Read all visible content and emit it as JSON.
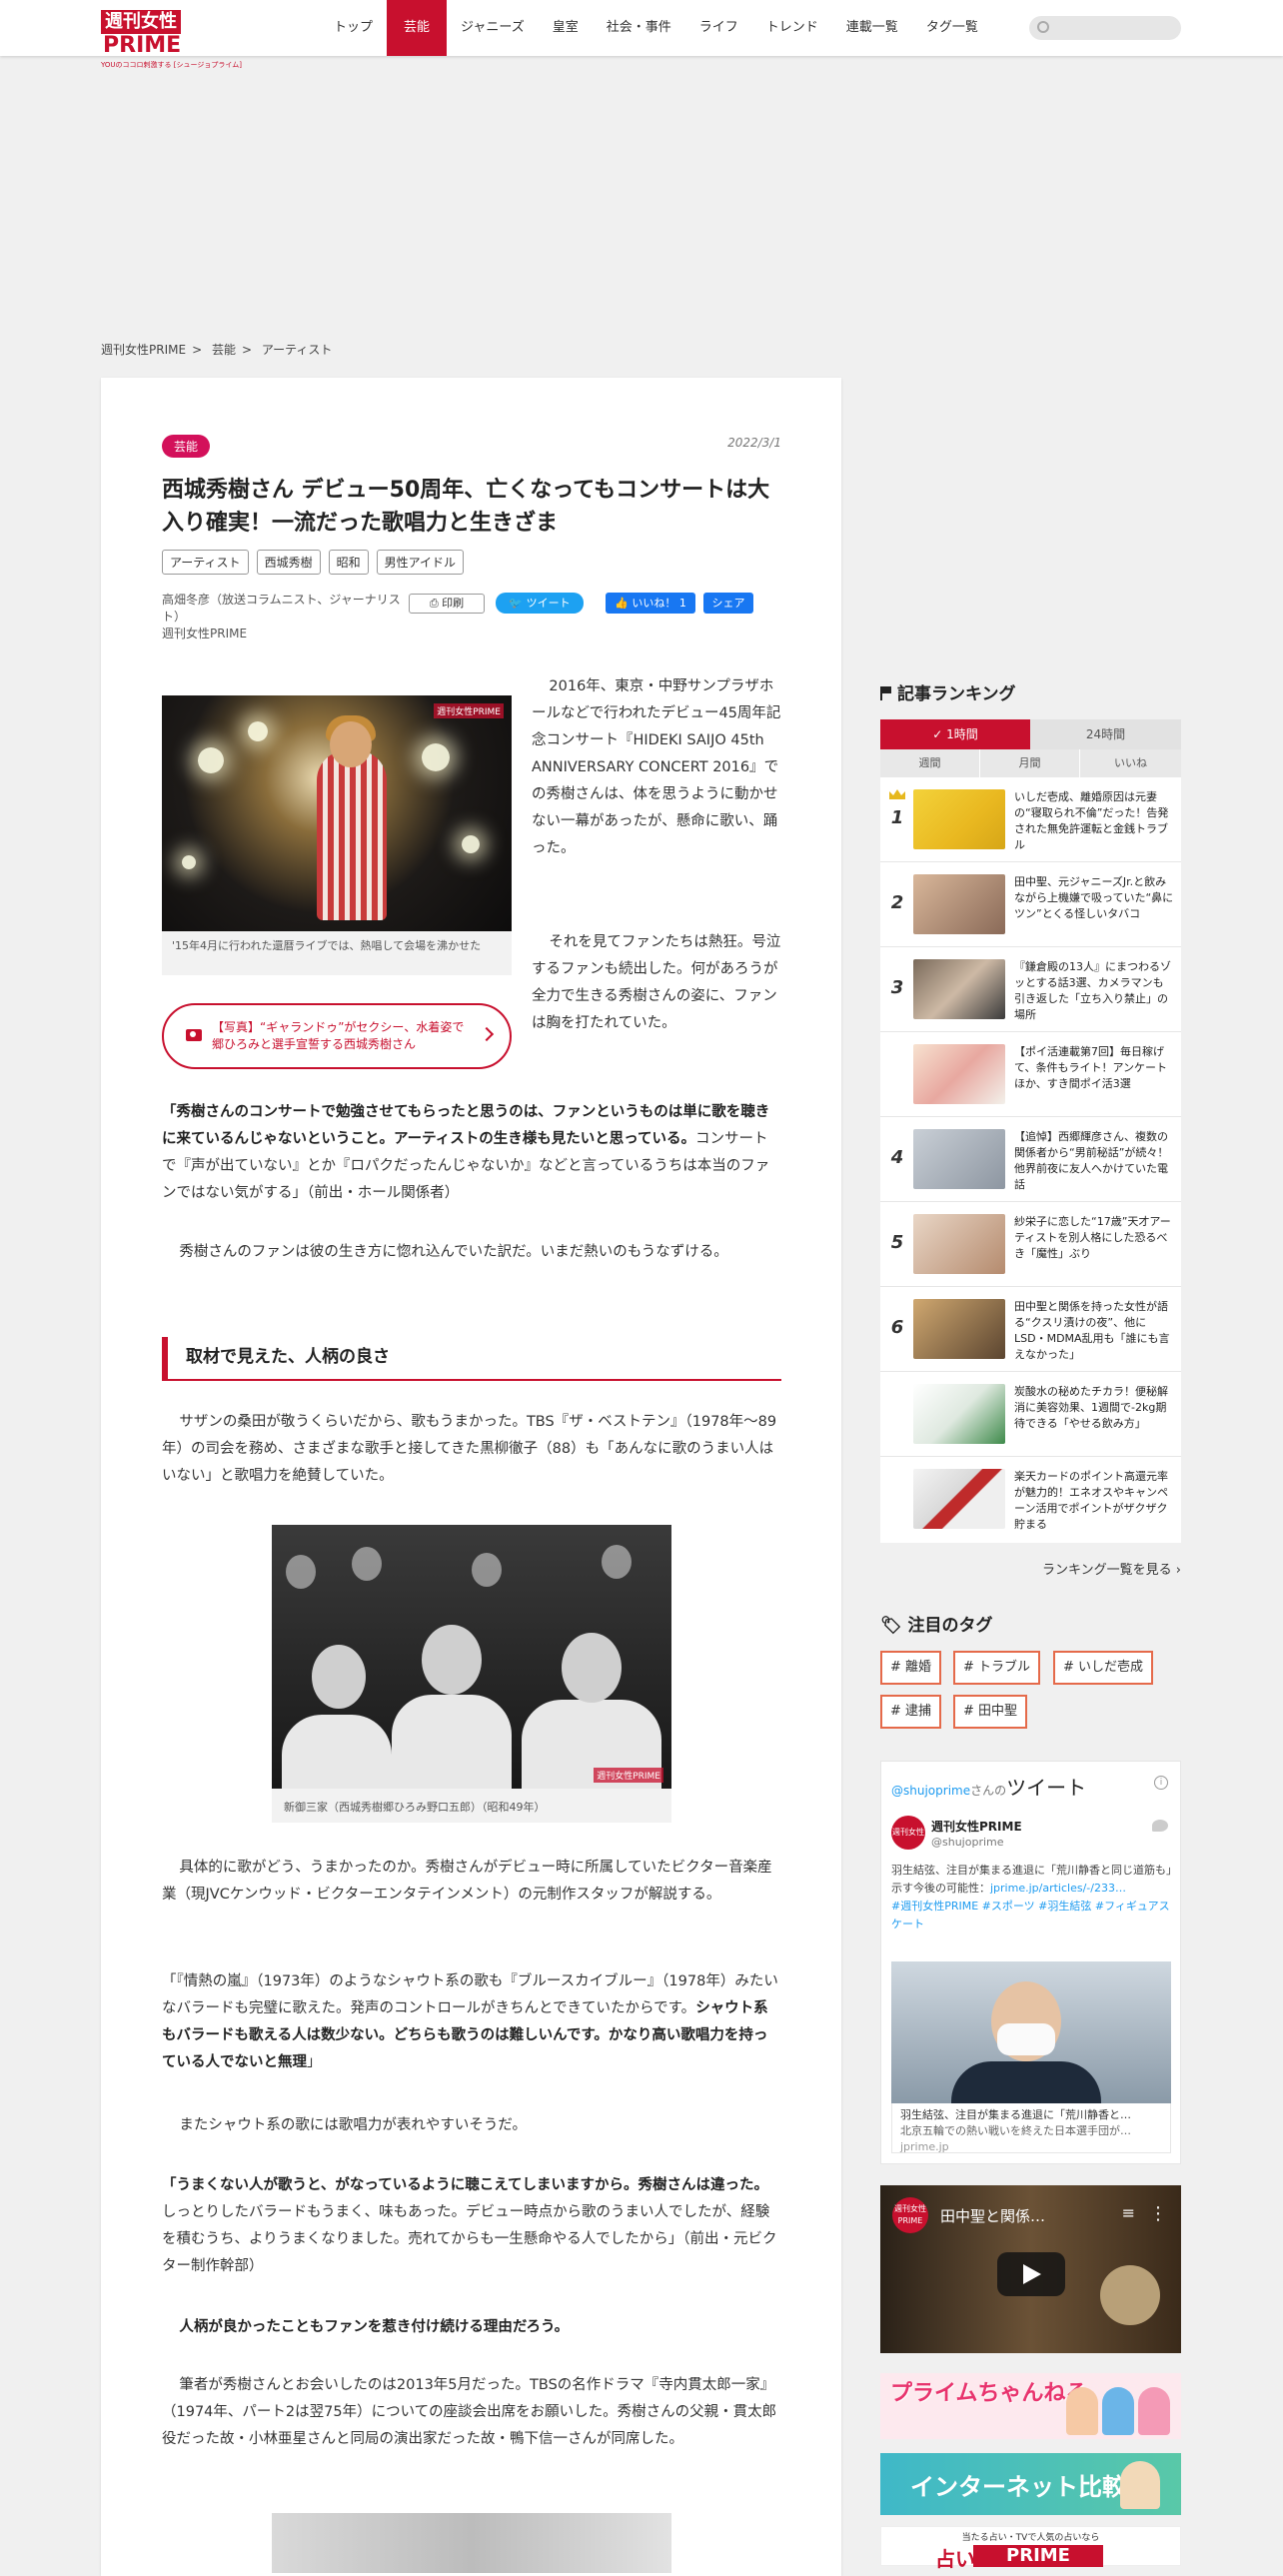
{
  "header": {
    "logo_main": "週刊女性",
    "logo_prime": "PRIME",
    "logo_sub": "YOUのココロ刺激する [シュージョプライム]",
    "nav": [
      "トップ",
      "芸能",
      "ジャニーズ",
      "皇室",
      "社会・事件",
      "ライフ",
      "トレンド",
      "連載一覧",
      "タグ一覧"
    ],
    "nav_active": "芸能",
    "search_placeholder": ""
  },
  "breadcrumb": [
    "週刊女性PRIME",
    "芸能",
    "アーティスト"
  ],
  "breadcrumb_sep": ">",
  "article": {
    "category": "芸能",
    "date": "2022/3/1",
    "title": "西城秀樹さん デビュー50周年、亡くなってもコンサートは大入り確実！一流だった歌唱力と生きざま",
    "tags": [
      "アーティスト",
      "西城秀樹",
      "昭和",
      "男性アイドル"
    ],
    "author": "高畑冬彦（放送コラムニスト、ジャーナリスト）",
    "publisher": "週刊女性PRIME",
    "print_label": "印刷",
    "tweet_label": "ツイート",
    "like_label": "いいね！ 1",
    "share_label": "シェア",
    "watermark": "週刊女性PRIME",
    "photo1_caption": "'15年4月に行われた還暦ライブでは、熱唱して会場を沸かせた",
    "photo_link": "【写真】“ギャランドゥ”がセクシー、水着姿で郷ひろみと選手宣誓する西城秀樹さん",
    "p1": "2016年、東京・中野サンプラザホールなどで行われたデビュー45周年記念コンサート『HIDEKI SAIJO 45th ANNIVERSARY CONCERT 2016』での秀樹さんは、体を思うように動かせない一幕があったが、懸命に歌い、踊った。",
    "p2": "それを見てファンたちは熱狂。号泣するファンも続出した。何があろうが全力で生きる秀樹さんの姿に、ファンは胸を打たれていた。",
    "p3_bold": "「秀樹さんのコンサートで勉強させてもらったと思うのは、ファンというものは単に歌を聴きに来ているんじゃないということ。アーティストの生き様も見たいと思っている。",
    "p3_rest": "コンサートで『声が出ていない』とか『ロパクだったんじゃないか』などと言っているうちは本当のファンではない気がする」（前出・ホール関係者）",
    "p4": "秀樹さんのファンは彼の生き方に惚れ込んでいた訳だ。いまだ熱いのもうなずける。",
    "h2": "取材で見えた、人柄の良さ",
    "p5": "サザンの桑田が敬うくらいだから、歌もうまかった。TBS『ザ・ベストテン』（1978年～89年）の司会を務め、さまざまな歌手と接してきた黒柳徹子（88）も「あんなに歌のうまい人はいない」と歌唱力を絶賛していた。",
    "photo2_caption": "新御三家（西城秀樹郷ひろみ野口五郎）（昭和49年）",
    "p6": "具体的に歌がどう、うまかったのか。秀樹さんがデビュー時に所属していたビクター音楽産業（現JVCケンウッド・ビクターエンタテインメント）の元制作スタッフが解説する。",
    "p7_a": "「『情熱の嵐』（1973年）のようなシャウト系の歌も『ブルースカイブルー』（1978年）みたいなバラードも完璧に歌えた。発声のコントロールがきちんとできていたからです。",
    "p7_bold": "シャウト系もバラードも歌える人は数少ない。どちらも歌うのは難しいんです。かなり高い歌唱力を持っている人でないと無理",
    "p7_end": "」",
    "p8": "またシャウト系の歌には歌唱力が表れやすいそうだ。",
    "p9_bold": "「うまくない人が歌うと、がなっているように聴こえてしまいますから。秀樹さんは違った。",
    "p9_rest": "しっとりしたバラードもうまく、味もあった。デビュー時点から歌のうまい人でしたが、経験を積むうち、よりうまくなりました。売れてからも一生懸命やる人でしたから」（前出・元ビクター制作幹部）",
    "p10_bold": "人柄が良かったこともファンを惹き付け続ける理由だろう。",
    "p11": "筆者が秀樹さんとお会いしたのは2013年5月だった。TBSの名作ドラマ『寺内貫太郎一家』（1974年、パート2は翌75年）についての座談会出席をお願いした。秀樹さんの父親・貫太郎役だった故・小林亜星さんと同局の演出家だった故・鴨下信一さんが同席した。"
  },
  "ranking": {
    "title": "記事ランキング",
    "tab_active": "1時間",
    "tab_other": "24時間",
    "subtabs": [
      "週間",
      "月間",
      "いいね"
    ],
    "items": [
      {
        "rank": "1",
        "title": "いしだ壱成、離婚原因は元妻の“寝取られ不倫”だった！告発された無免許運転と金銭トラブル"
      },
      {
        "rank": "2",
        "title": "田中聖、元ジャニーズJr.と飲みながら上機嫌で吸っていた“鼻にツン”とくる怪しいタバコ"
      },
      {
        "rank": "3",
        "title": "『鎌倉殿の13人』にまつわるゾッとする話3選、カメラマンも引き返した「立ち入り禁止」の場所"
      },
      {
        "rank": "",
        "title": "【ポイ活連載第7回】毎日稼げて、条件もライト！アンケートほか、すき間ポイ活3選"
      },
      {
        "rank": "4",
        "title": "【追悼】西郷輝彦さん、複数の関係者から“男前秘話”が続々！他界前夜に友人へかけていた電話"
      },
      {
        "rank": "5",
        "title": "紗栄子に恋した“17歳”天才アーティストを別人格にした恐るべき「魔性」ぶり"
      },
      {
        "rank": "6",
        "title": "田中聖と関係を持った女性が語る“クスリ漬けの夜”、他にLSD・MDMA乱用も「誰にも言えなかった」"
      },
      {
        "rank": "",
        "title": "炭酸水の秘めたチカラ！便秘解消に美容効果、1週間で-2kg期待できる「やせる飲み方」"
      },
      {
        "rank": "",
        "title": "楽天カードのポイント高還元率が魅力的！エネオスやキャンペーン活用でポイントがザクザク貯まる"
      }
    ],
    "more": "ランキング一覧を見る"
  },
  "tags_section": {
    "title": "注目のタグ",
    "tags": [
      "# 離婚",
      "# トラブル",
      "# いしだ壱成",
      "# 逮捕",
      "# 田中聖"
    ]
  },
  "twitter": {
    "handle_link": "@shujoprime",
    "handle_suffix": "さんの",
    "label": "ツイート",
    "name": "週刊女性PRIME",
    "handle": "@shujoprime",
    "avatar_text": "週刊女性",
    "text": "羽生結弦、注目が集まる進退に「荒川静香と同じ道筋も」示す今後の可能性：",
    "link": "jprime.jp/articles/-/233…",
    "hashtags": "#週刊女性PRIME #スポーツ #羽生結弦 #フィギュアスケート",
    "card_title": "羽生結弦、注目が集まる進退に「荒川静香と…",
    "card_desc": "北京五輪での熱い戦いを終えた日本選手団が…",
    "card_domain": "jprime.jp"
  },
  "youtube": {
    "title": "田中聖と関係…",
    "avatar_text": "週刊女性PRIME"
  },
  "banners": {
    "b1": "プライムちゃんねる",
    "b2": "インターネット比較",
    "b3_sub": "当たる占い・TVで人気の占いなら",
    "b3_main": "PRIME",
    "b3_pre": "占い"
  },
  "colors": {
    "brand": "#c8102e",
    "twitter": "#1da1f2",
    "facebook": "#1877f2"
  }
}
